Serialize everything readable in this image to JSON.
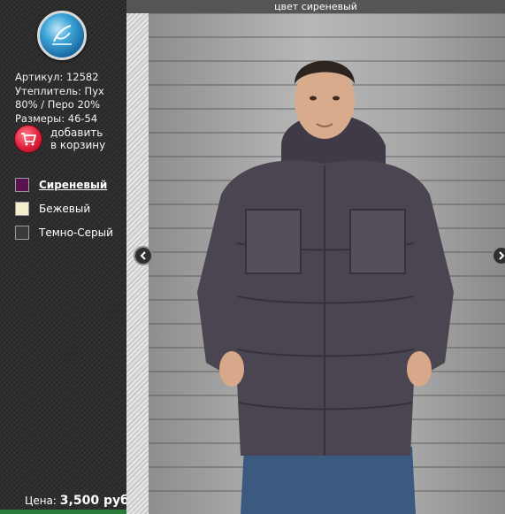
{
  "product": {
    "sku_line": "Артикул: 12582",
    "insulation_line1": "Утеплитель: Пух",
    "insulation_line2": "80% / Перо 20%",
    "sizes_line": "Размеры: 46-54"
  },
  "cart": {
    "label_line1": "добавить",
    "label_line2": "в корзину",
    "icon": "shopping-cart-icon"
  },
  "colors": [
    {
      "label": "Сиреневый",
      "swatch": "#5a1150",
      "selected": true
    },
    {
      "label": "Бежевый",
      "swatch": "#f6efcf",
      "selected": false
    },
    {
      "label": "Темно-Серый",
      "swatch": "#3a3a3a",
      "selected": false
    }
  ],
  "price": {
    "label": "Цена:",
    "amount": "3,500 руб."
  },
  "gallery": {
    "caption": "цвет сиреневый",
    "prev_icon": "chevron-left-icon",
    "next_icon": "chevron-right-icon"
  },
  "theme": {
    "sidebar_bg": "#2e2e2e",
    "header_bg": "#555555",
    "jacket_color": "#4a4550",
    "cart_red": "#e0203a"
  }
}
